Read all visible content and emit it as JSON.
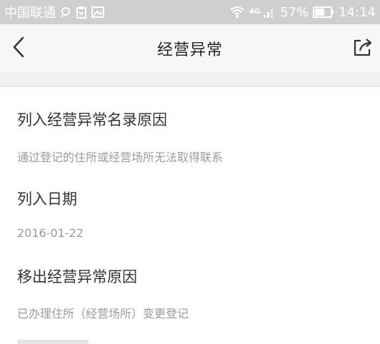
{
  "status_bar": {
    "carrier": "中国联通",
    "battery": "57%",
    "time": "14:14",
    "network": "4G"
  },
  "nav": {
    "title": "经营异常"
  },
  "fields": [
    {
      "label": "列入经营异常名录原因",
      "value": "通过登记的住所或经营场所无法取得联系"
    },
    {
      "label": "列入日期",
      "value": "2016-01-22"
    },
    {
      "label": "移出经营异常原因",
      "value": "已办理住所（经营场所）变更登记"
    }
  ],
  "icons": {
    "back": "chevron-left-icon",
    "share": "share-icon"
  }
}
